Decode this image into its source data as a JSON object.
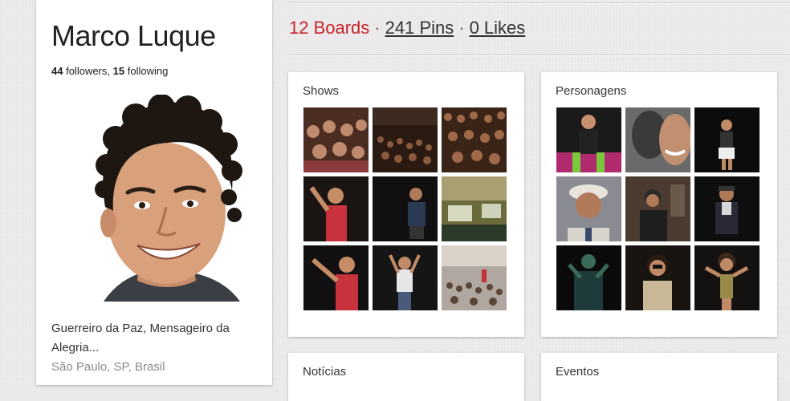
{
  "profile": {
    "name": "Marco Luque",
    "followers_count": "44",
    "followers_label": "followers,",
    "following_count": "15",
    "following_label": "following",
    "bio": "Guerreiro da Paz, Mensageiro da Alegria...",
    "location": "São Paulo, SP, Brasil"
  },
  "stats": {
    "boards": "12 Boards",
    "pins": "241 Pins",
    "likes": "0 Likes",
    "separator": "·"
  },
  "boards": [
    {
      "title": "Shows"
    },
    {
      "title": "Personagens"
    },
    {
      "title": "Notícias"
    },
    {
      "title": "Eventos"
    }
  ],
  "colors": {
    "brand_red": "#c8232c",
    "background": "#ebe9e9",
    "card": "#ffffff"
  }
}
